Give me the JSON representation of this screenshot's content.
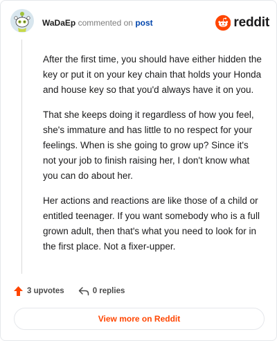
{
  "comment": {
    "username": "WaDaEp",
    "commented_text": "commented on",
    "post_link": "post",
    "paragraphs": [
      "After the first time, you should have either hidden the key or put it on your key chain that holds your Honda and house key so that you'd always have it on you.",
      "That she keeps doing it regardless of how you feel, she's immature and has little to no respect for your feelings. When is she going to grow up? Since it's not your job to finish raising her, I don't know what you can do about her.",
      "Her actions and reactions are like those of a child or entitled teenager. If you want somebody who is a full grown adult, then that's what you need to look for in the first place. Not a fixer-upper."
    ],
    "upvotes": "3 upvotes",
    "replies": "0 replies"
  },
  "brand": {
    "name": "reddit",
    "color": "#ff4500",
    "icon": "reddit-logo-icon"
  },
  "footer": {
    "view_more": "View more on Reddit"
  },
  "icons": {
    "upvote": "upvote-arrow-icon",
    "reply": "reply-arrow-icon",
    "avatar": "snoo-avatar"
  },
  "colors": {
    "accent": "#ff4500",
    "link": "#0045ac",
    "muted": "#7c7c7c"
  }
}
